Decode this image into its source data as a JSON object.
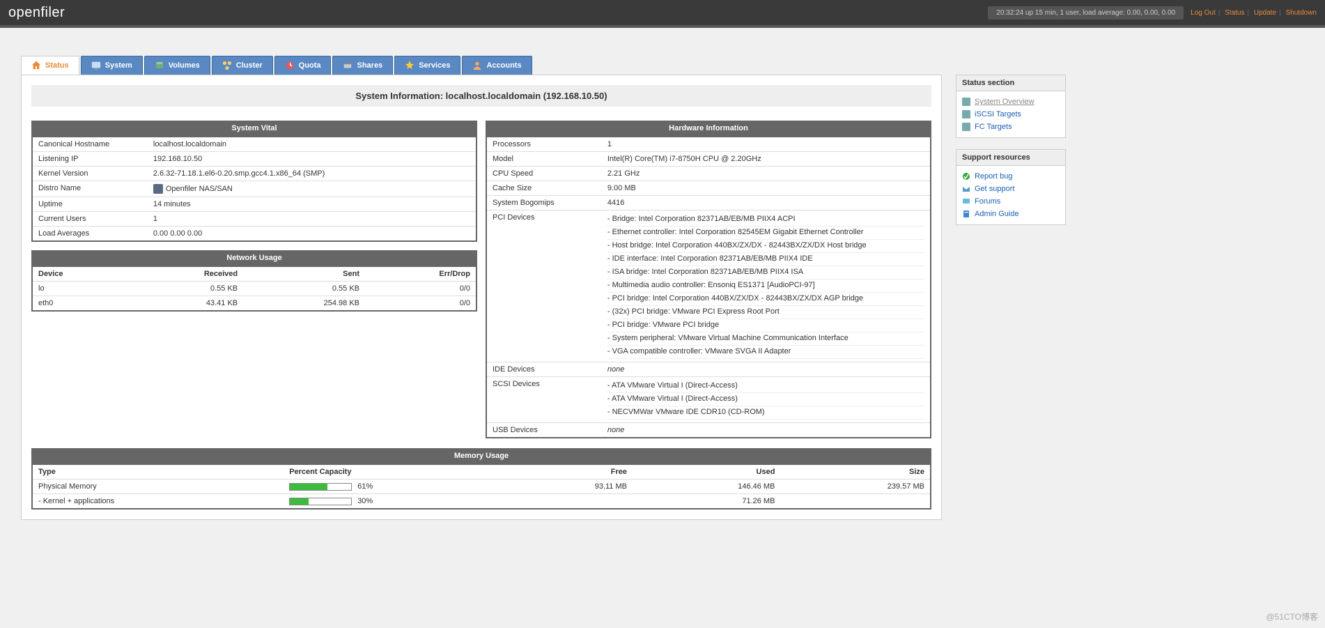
{
  "header": {
    "logo": "openfiler",
    "uptime_text": "20:32:24 up 15 min, 1 user, load average: 0.00, 0.00, 0.00",
    "links": [
      "Log Out",
      "Status",
      "Update",
      "Shutdown"
    ]
  },
  "tabs": [
    {
      "label": "Status",
      "active": true
    },
    {
      "label": "System",
      "active": false
    },
    {
      "label": "Volumes",
      "active": false
    },
    {
      "label": "Cluster",
      "active": false
    },
    {
      "label": "Quota",
      "active": false
    },
    {
      "label": "Shares",
      "active": false
    },
    {
      "label": "Services",
      "active": false
    },
    {
      "label": "Accounts",
      "active": false
    }
  ],
  "page_title": "System Information: localhost.localdomain (192.168.10.50)",
  "system_vital": {
    "caption": "System Vital",
    "rows": [
      {
        "label": "Canonical Hostname",
        "value": "localhost.localdomain"
      },
      {
        "label": "Listening IP",
        "value": "192.168.10.50"
      },
      {
        "label": "Kernel Version",
        "value": "2.6.32-71.18.1.el6-0.20.smp.gcc4.1.x86_64 (SMP)"
      },
      {
        "label": "Distro Name",
        "value": "Openfiler NAS/SAN",
        "icon": true
      },
      {
        "label": "Uptime",
        "value": "14 minutes"
      },
      {
        "label": "Current Users",
        "value": "1"
      },
      {
        "label": "Load Averages",
        "value": "0.00 0.00 0.00"
      }
    ]
  },
  "network_usage": {
    "caption": "Network Usage",
    "headers": [
      "Device",
      "Received",
      "Sent",
      "Err/Drop"
    ],
    "rows": [
      {
        "device": "lo",
        "received": "0.55 KB",
        "sent": "0.55 KB",
        "errdrop": "0/0"
      },
      {
        "device": "eth0",
        "received": "43.41 KB",
        "sent": "254.98 KB",
        "errdrop": "0/0"
      }
    ]
  },
  "hardware": {
    "caption": "Hardware Information",
    "rows": {
      "processors": {
        "label": "Processors",
        "value": "1"
      },
      "model": {
        "label": "Model",
        "value": "Intel(R) Core(TM) i7-8750H CPU @ 2.20GHz"
      },
      "cpu_speed": {
        "label": "CPU Speed",
        "value": "2.21 GHz"
      },
      "cache_size": {
        "label": "Cache Size",
        "value": "9.00 MB"
      },
      "bogomips": {
        "label": "System Bogomips",
        "value": "4416"
      },
      "pci": {
        "label": "PCI Devices",
        "list": [
          "Bridge: Intel Corporation 82371AB/EB/MB PIIX4 ACPI",
          "Ethernet controller: Intel Corporation 82545EM Gigabit Ethernet Controller",
          "Host bridge: Intel Corporation 440BX/ZX/DX - 82443BX/ZX/DX Host bridge",
          "IDE interface: Intel Corporation 82371AB/EB/MB PIIX4 IDE",
          "ISA bridge: Intel Corporation 82371AB/EB/MB PIIX4 ISA",
          "Multimedia audio controller: Ensoniq ES1371 [AudioPCI-97]",
          "PCI bridge: Intel Corporation 440BX/ZX/DX - 82443BX/ZX/DX AGP bridge",
          "(32x) PCI bridge: VMware PCI Express Root Port",
          "PCI bridge: VMware PCI bridge",
          "System peripheral: VMware Virtual Machine Communication Interface",
          "VGA compatible controller: VMware SVGA II Adapter"
        ]
      },
      "ide": {
        "label": "IDE Devices",
        "value": "none",
        "italic": true
      },
      "scsi": {
        "label": "SCSI Devices",
        "list": [
          "ATA VMware Virtual I (Direct-Access)",
          "ATA VMware Virtual I (Direct-Access)",
          "NECVMWar VMware IDE CDR10 (CD-ROM)"
        ]
      },
      "usb": {
        "label": "USB Devices",
        "value": "none",
        "italic": true
      }
    }
  },
  "memory": {
    "caption": "Memory Usage",
    "headers": [
      "Type",
      "Percent Capacity",
      "Free",
      "Used",
      "Size"
    ],
    "rows": [
      {
        "type": "Physical Memory",
        "percent": 61,
        "free": "93.11 MB",
        "used": "146.46 MB",
        "size": "239.57 MB"
      },
      {
        "type": "- Kernel + applications",
        "percent": 30,
        "free": "",
        "used": "71.26 MB",
        "size": ""
      }
    ]
  },
  "sidebar": {
    "status": {
      "title": "Status section",
      "items": [
        {
          "label": "System Overview",
          "active": true
        },
        {
          "label": "iSCSI Targets",
          "active": false
        },
        {
          "label": "FC Targets",
          "active": false
        }
      ]
    },
    "support": {
      "title": "Support resources",
      "items": [
        {
          "label": "Report bug"
        },
        {
          "label": "Get support"
        },
        {
          "label": "Forums"
        },
        {
          "label": "Admin Guide"
        }
      ]
    }
  },
  "watermark": "@51CTO博客"
}
